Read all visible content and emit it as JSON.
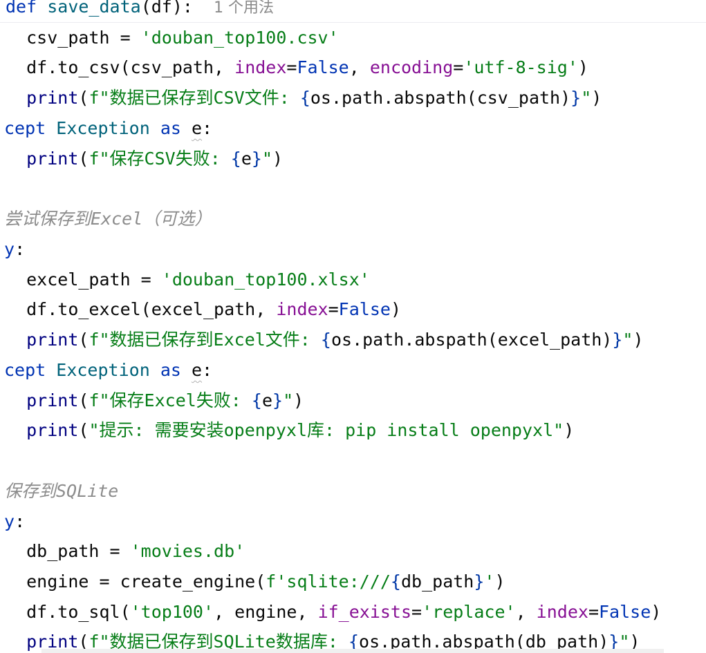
{
  "editor": {
    "lines": {
      "l0": {
        "kw": "def",
        "fn": "save_data",
        "args": "(df):",
        "hint": "1 个用法"
      },
      "l1": {
        "name": "csv_path",
        "op": " = ",
        "str": "'douban_top100.csv'"
      },
      "l2": {
        "pre": "df.to_csv(csv_path, ",
        "k1": "index",
        "eq1": "=",
        "v1": "False",
        "mid": ", ",
        "k2": "encoding",
        "eq2": "=",
        "v2": "'utf-8-sig'",
        "end": ")"
      },
      "l3": {
        "print": "print",
        "open": "(",
        "s1": "f\"数据已保存到CSV文件: ",
        "b1": "{",
        "expr": "os.path.abspath(csv_path)",
        "b2": "}",
        "s2": "\"",
        "close": ")"
      },
      "l4": {
        "kw1": "cept",
        "cls": "Exception",
        "kw2": "as",
        "var": "e",
        "colon": ":"
      },
      "l5": {
        "print": "print",
        "open": "(",
        "s1": "f\"保存CSV失败: ",
        "b1": "{",
        "expr": "e",
        "b2": "}",
        "s2": "\"",
        "close": ")"
      },
      "l7": {
        "comment": "尝试保存到Excel（可选）"
      },
      "l8": {
        "kw": "y",
        "colon": ":"
      },
      "l9": {
        "name": "excel_path",
        "op": " = ",
        "str": "'douban_top100.xlsx'"
      },
      "l10": {
        "pre": "df.to_excel(excel_path, ",
        "k1": "index",
        "eq1": "=",
        "v1": "False",
        "end": ")"
      },
      "l11": {
        "print": "print",
        "open": "(",
        "s1": "f\"数据已保存到Excel文件: ",
        "b1": "{",
        "expr": "os.path.abspath(excel_path)",
        "b2": "}",
        "s2": "\"",
        "close": ")"
      },
      "l12": {
        "kw1": "cept",
        "cls": "Exception",
        "kw2": "as",
        "var": "e",
        "colon": ":"
      },
      "l13": {
        "print": "print",
        "open": "(",
        "s1": "f\"保存Excel失败: ",
        "b1": "{",
        "expr": "e",
        "b2": "}",
        "s2": "\"",
        "close": ")"
      },
      "l14": {
        "print": "print",
        "open": "(",
        "str": "\"提示: 需要安装openpyxl库: pip install openpyxl\"",
        "close": ")"
      },
      "l16": {
        "comment": "保存到SQLite"
      },
      "l17": {
        "kw": "y",
        "colon": ":"
      },
      "l18": {
        "name": "db_path",
        "op": " = ",
        "str": "'movies.db'"
      },
      "l19": {
        "pre": "engine = create_engine(",
        "s1": "f'sqlite:///",
        "b1": "{",
        "expr": "db_path",
        "b2": "}",
        "s2": "'",
        "close": ")"
      },
      "l20": {
        "pre": "df.to_sql(",
        "s0": "'top100'",
        "mid": ", engine, ",
        "k1": "if_exists",
        "eq1": "=",
        "v1": "'replace'",
        "mid2": ", ",
        "k2": "index",
        "eq2": "=",
        "v2": "False",
        "end": ")"
      },
      "l21": {
        "print": "print",
        "open": "(",
        "s1": "f\"数据已保存到SQLite数据库: ",
        "b1": "{",
        "expr": "os.path.abspath(db_path)",
        "b2": "}",
        "s2": "\"",
        "close": ")"
      }
    }
  }
}
